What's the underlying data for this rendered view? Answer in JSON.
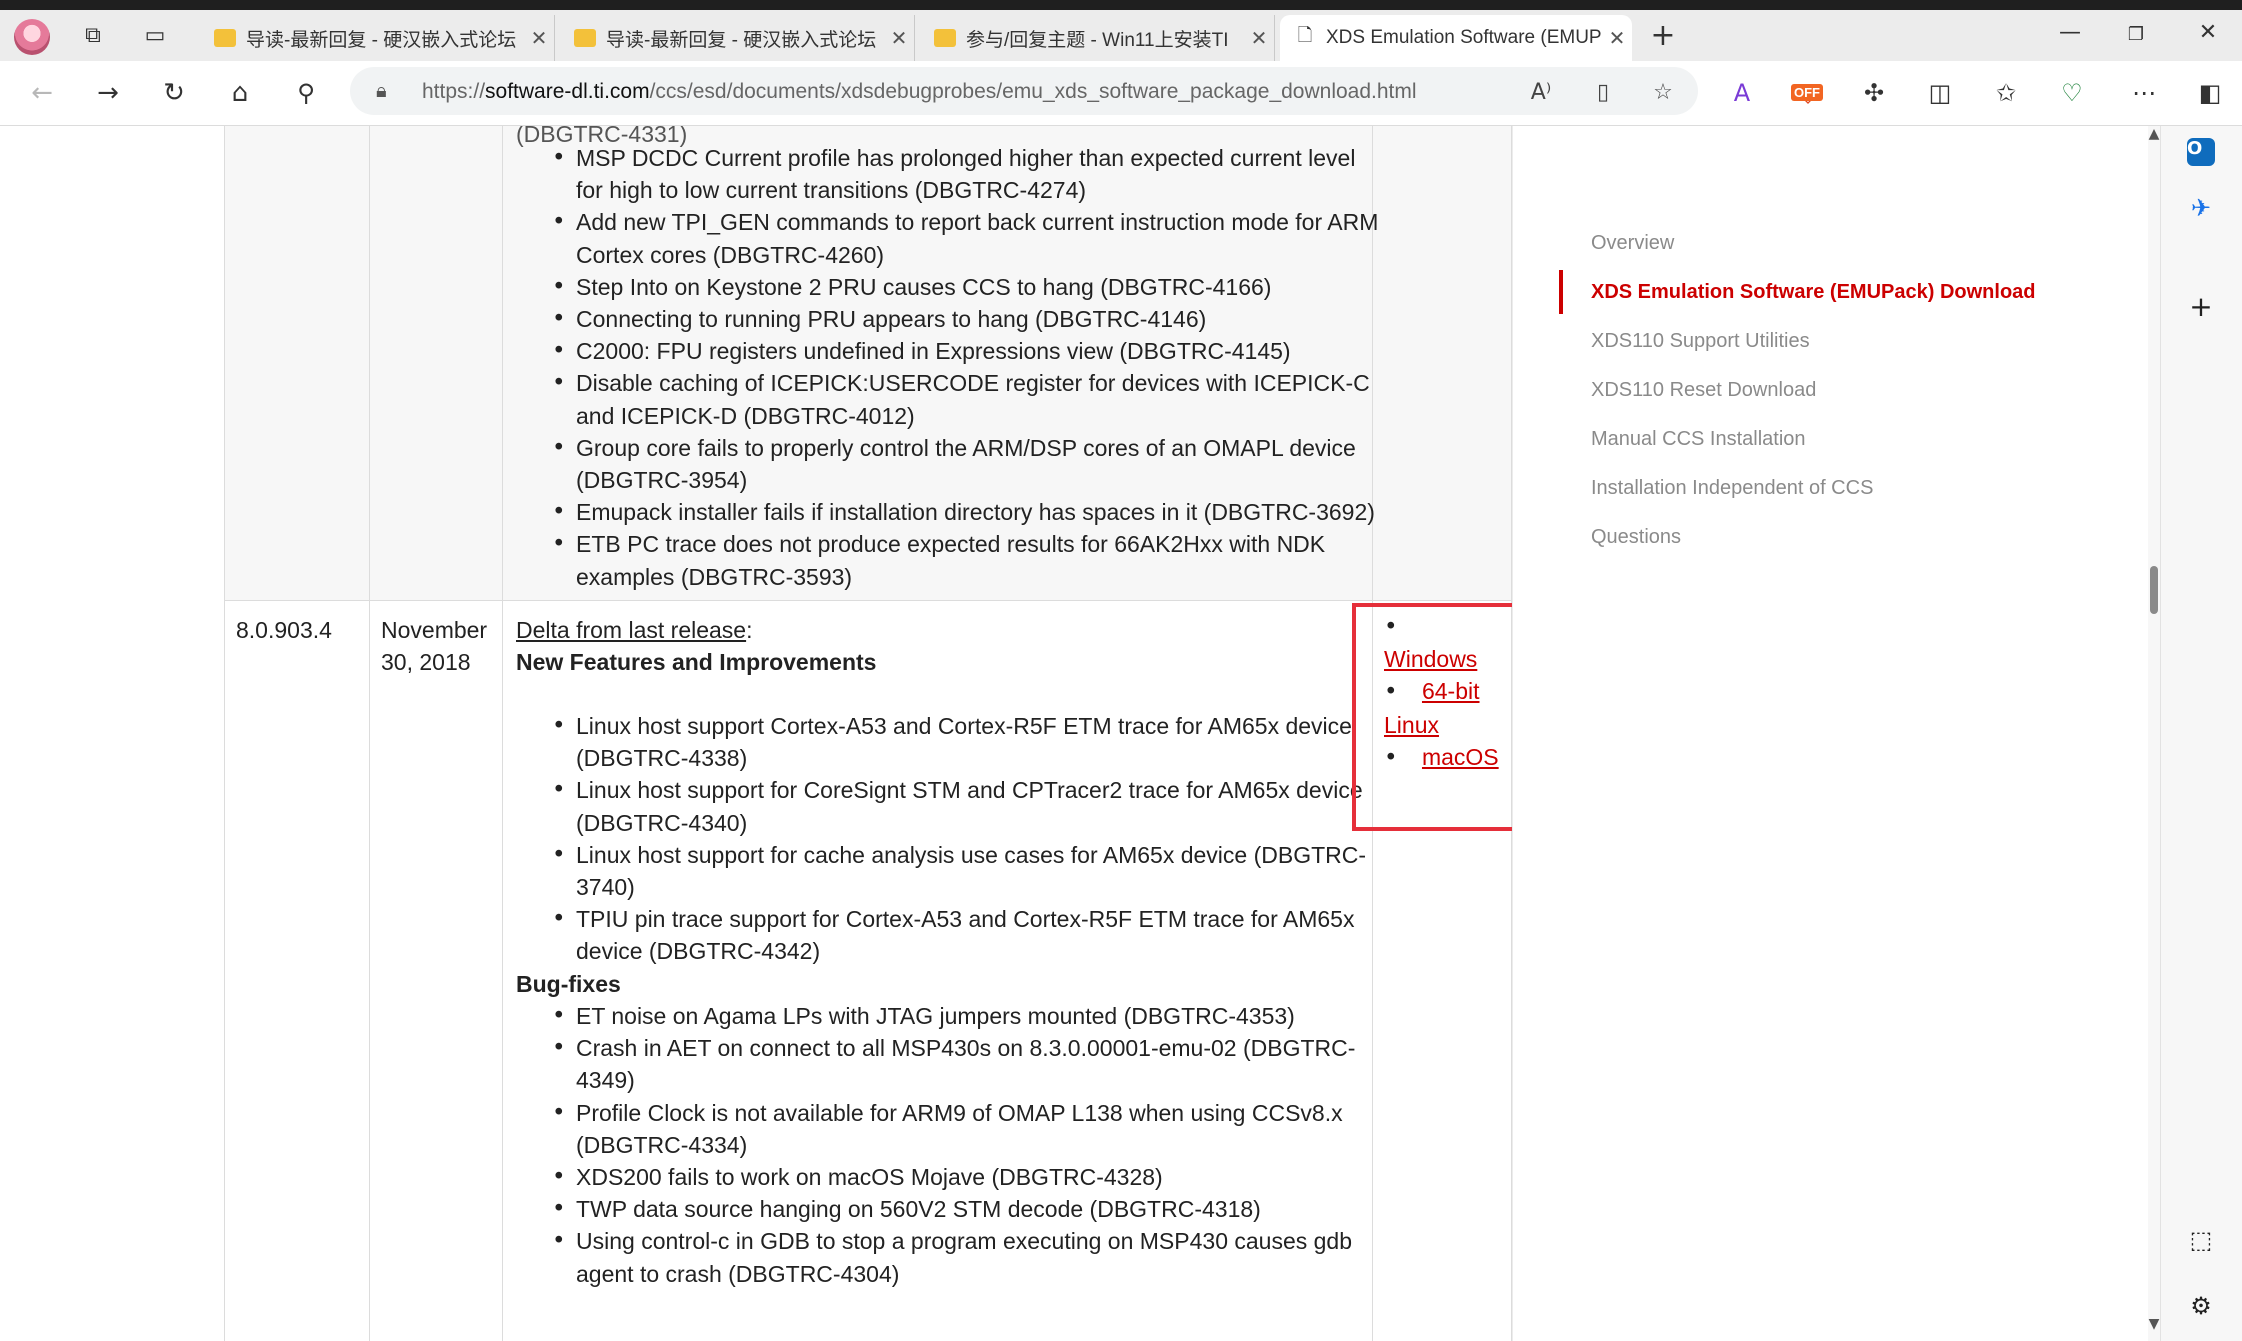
{
  "browser": {
    "tabs": [
      {
        "title": "导读-最新回复 - 硬汉嵌入式论坛"
      },
      {
        "title": "导读-最新回复 - 硬汉嵌入式论坛"
      },
      {
        "title": "参与/回复主题 - Win11上安装TI"
      },
      {
        "title": "XDS Emulation Software (EMUPa"
      }
    ],
    "new_tab": "+",
    "url_scheme": "https://",
    "url_host": "software-dl.ti.com",
    "url_path": "/ccs/esd/documents/xdsdebugprobes/emu_xds_software_package_download.html",
    "off_badge": "OFF",
    "colors": {
      "accent": "#cc0000",
      "highlight_box": "#e52f3a"
    }
  },
  "table": {
    "row1": {
      "items": [
        "MSP DCDC Current profile has prolonged higher than expected current level",
        "for high to low current transitions (DBGTRC-4274)",
        "Add new TPI_GEN commands to report back current instruction mode for ARM",
        "Cortex cores (DBGTRC-4260)",
        "Step Into on Keystone 2 PRU causes CCS to hang (DBGTRC-4166)",
        "Connecting to running PRU appears to hang (DBGTRC-4146)",
        "C2000: FPU registers undefined in Expressions view (DBGTRC-4145)",
        "Disable caching of ICEPICK:USERCODE register for devices with ICEPICK-C",
        "and ICEPICK-D (DBGTRC-4012)",
        "Group core fails to properly control the ARM/DSP cores of an OMAPL device",
        "(DBGTRC-3954)",
        "Emupack installer fails if installation directory has spaces in it (DBGTRC-3692)",
        "ETB PC trace does not produce expected results for 66AK2Hxx with NDK",
        "examples (DBGTRC-3593)"
      ]
    },
    "row2": {
      "version": "8.0.903.4",
      "date_line1": "November",
      "date_line2": "30, 2018",
      "delta_link": "Delta from last release",
      "delta_colon": ":",
      "features_heading": "New Features and Improvements",
      "features": [
        "Linux host support Cortex-A53 and Cortex-R5F ETM trace for AM65x device",
        "(DBGTRC-4338)",
        "Linux host support for CoreSignt STM and CPTracer2 trace for AM65x device",
        "(DBGTRC-4340)",
        "Linux host support for cache analysis use cases for AM65x device (DBGTRC-",
        "3740)",
        "TPIU pin trace support for Cortex-A53 and Cortex-R5F ETM trace for AM65x",
        "device (DBGTRC-4342)"
      ],
      "bugfix_heading": "Bug-fixes",
      "bugfixes": [
        "ET noise on Agama LPs with JTAG jumpers mounted (DBGTRC-4353)",
        "Crash in AET on connect to all MSP430s on 8.3.0.00001-emu-02 (DBGTRC-",
        "4349)",
        "Profile Clock is not available for ARM9 of OMAP L138 when using CCSv8.x",
        "(DBGTRC-4334)",
        "XDS200 fails to work on macOS Mojave (DBGTRC-4328)",
        "TWP data source hanging on 560V2 STM decode (DBGTRC-4318)",
        "Using control-c in GDB to stop a program executing on MSP430 causes gdb",
        "agent to crash (DBGTRC-4304)"
      ],
      "downloads": {
        "windows": "Windows",
        "bit64": "64-bit",
        "linux": "Linux",
        "macos": "macOS"
      }
    }
  },
  "toc": {
    "items": [
      {
        "label": "Overview"
      },
      {
        "label": "XDS Emulation Software (EMUPack) Download"
      },
      {
        "label": "XDS110 Support Utilities"
      },
      {
        "label": "XDS110 Reset Download"
      },
      {
        "label": "Manual CCS Installation"
      },
      {
        "label": "Installation Independent of CCS"
      },
      {
        "label": "Questions"
      }
    ]
  }
}
